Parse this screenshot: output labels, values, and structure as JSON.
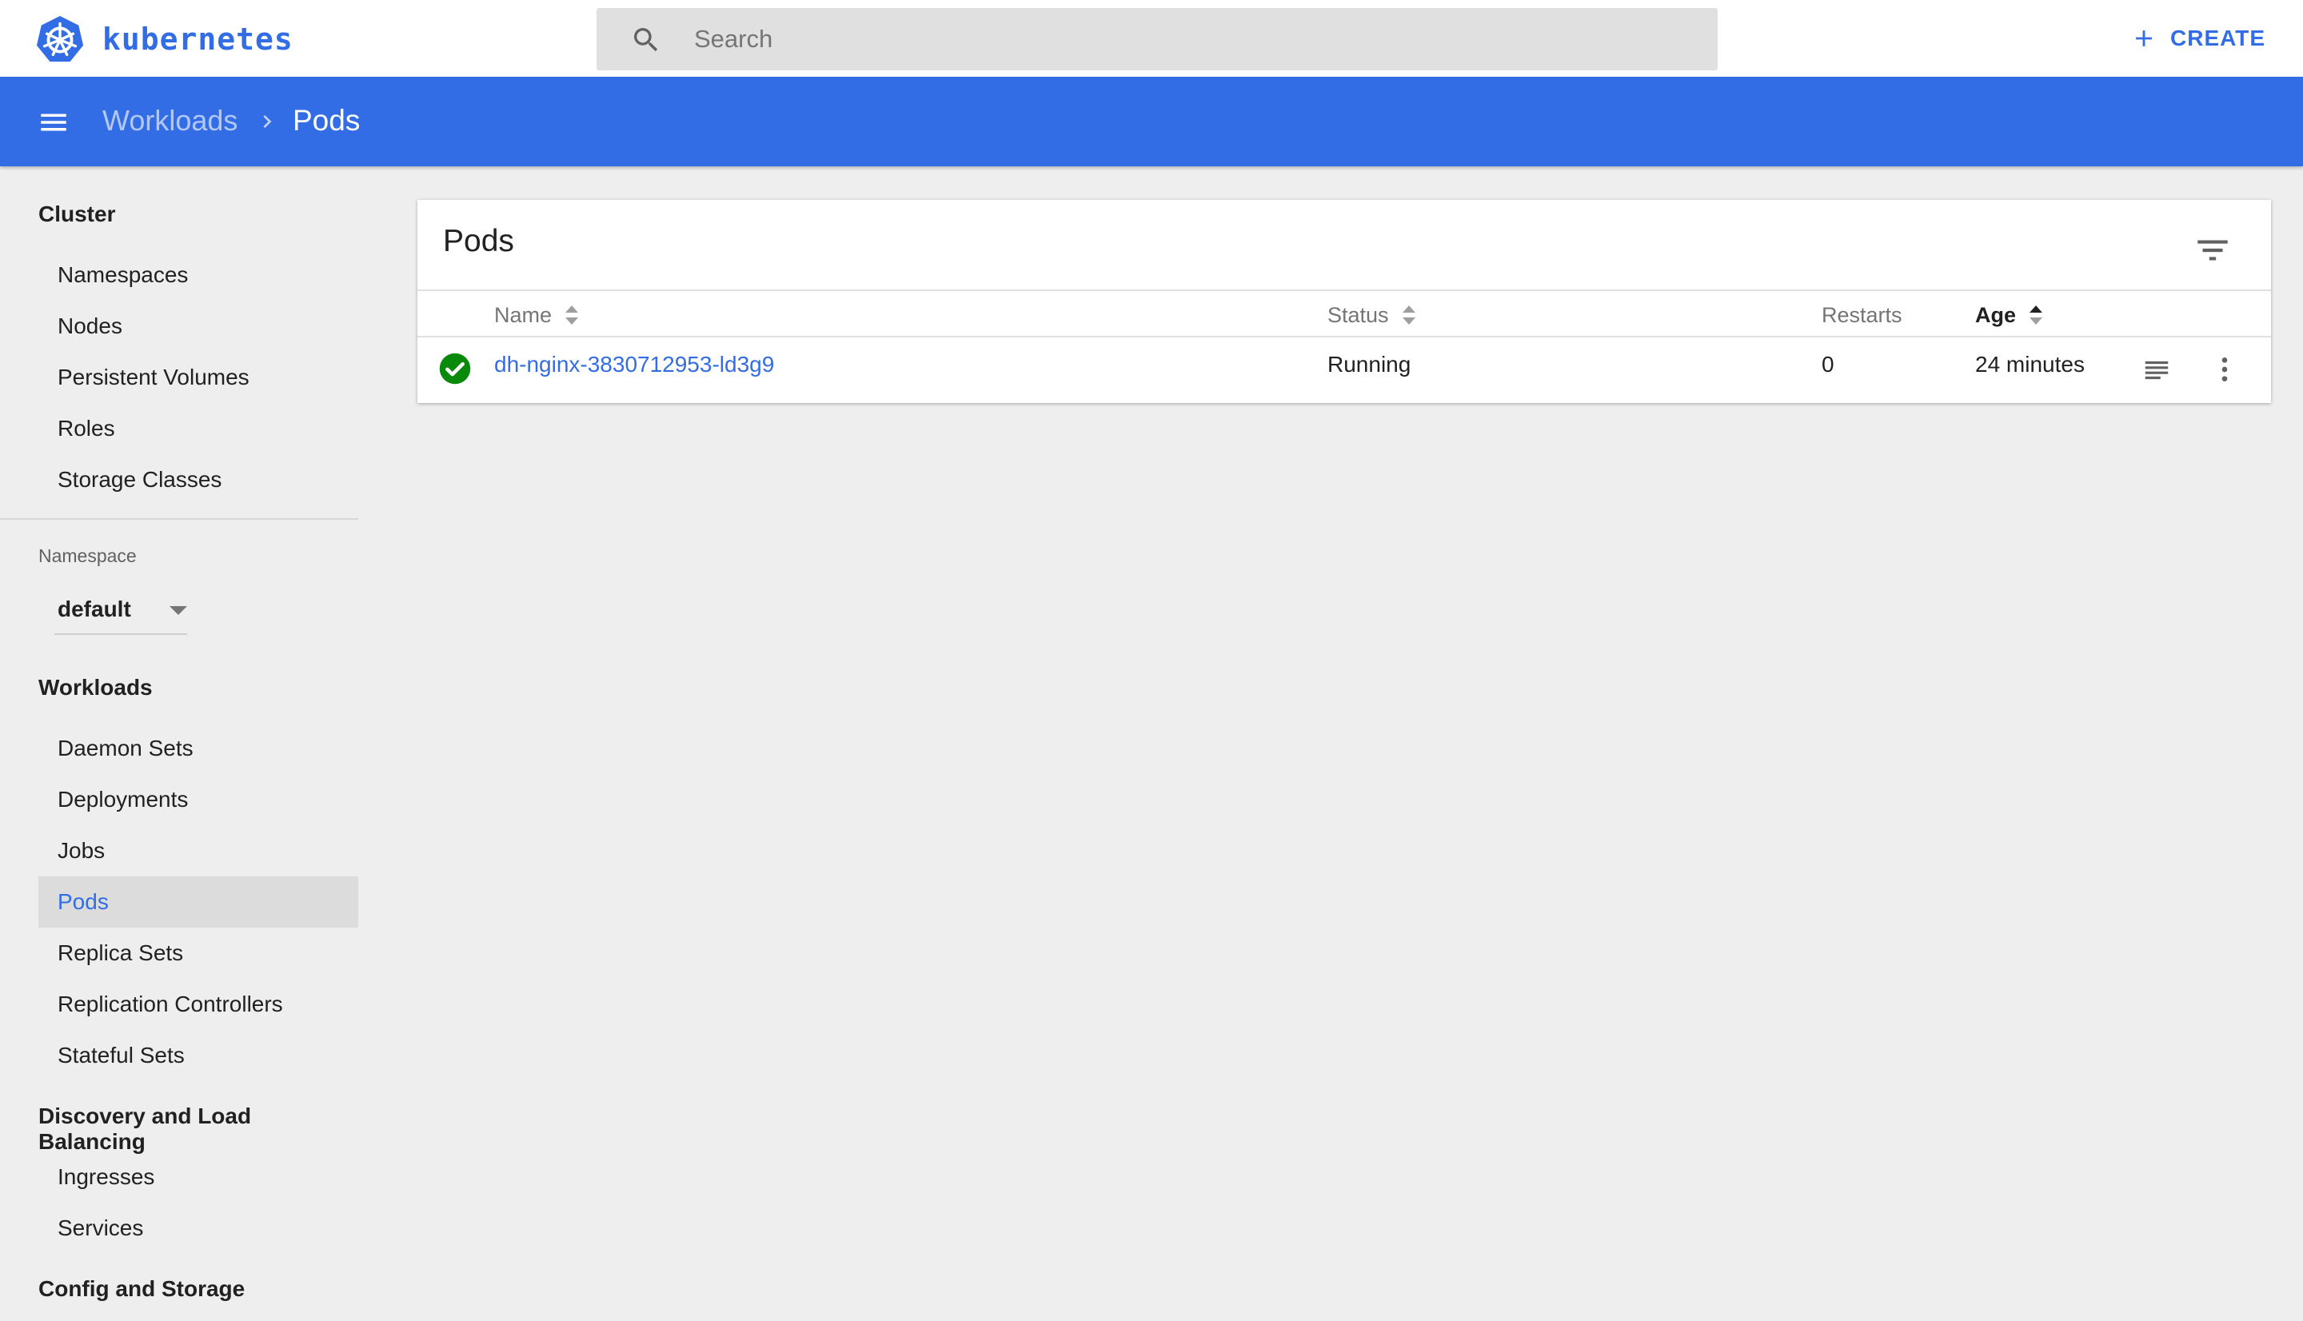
{
  "app": {
    "logo_text": "kubernetes",
    "brand_color": "#326de6",
    "create_label": "CREATE"
  },
  "search": {
    "placeholder": "Search",
    "value": ""
  },
  "breadcrumb": {
    "parent": "Workloads",
    "current": "Pods"
  },
  "sidebar": {
    "cluster": {
      "title": "Cluster",
      "items": [
        "Namespaces",
        "Nodes",
        "Persistent Volumes",
        "Roles",
        "Storage Classes"
      ]
    },
    "namespace": {
      "label": "Namespace",
      "selected": "default"
    },
    "workloads": {
      "title": "Workloads",
      "items": [
        "Daemon Sets",
        "Deployments",
        "Jobs",
        "Pods",
        "Replica Sets",
        "Replication Controllers",
        "Stateful Sets"
      ],
      "active": "Pods"
    },
    "discovery": {
      "title": "Discovery and Load Balancing",
      "items": [
        "Ingresses",
        "Services"
      ]
    },
    "config": {
      "title": "Config and Storage"
    }
  },
  "pods_card": {
    "title": "Pods",
    "columns": {
      "name": "Name",
      "status": "Status",
      "restarts": "Restarts",
      "age": "Age"
    },
    "rows": [
      {
        "status_icon": "check-circle-icon",
        "status_color": "#0a8a0a",
        "name": "dh-nginx-3830712953-ld3g9",
        "status": "Running",
        "restarts": "0",
        "age": "24 minutes"
      }
    ]
  }
}
